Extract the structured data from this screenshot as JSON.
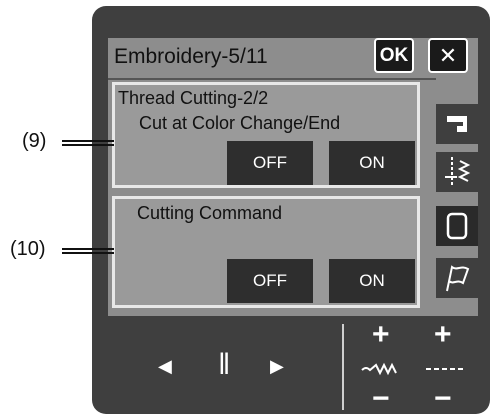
{
  "header": {
    "title": "Embroidery-5/11",
    "ok_label": "OK",
    "close_label": "✕"
  },
  "settings": {
    "thread_cutting": {
      "title": "Thread Cutting-2/2",
      "subtitle": "Cut at Color Change/End",
      "off_label": "OFF",
      "on_label": "ON"
    },
    "cutting_command": {
      "title": "Cutting Command",
      "off_label": "OFF",
      "on_label": "ON"
    }
  },
  "callouts": {
    "c9": "(9)",
    "c10": "(10)"
  },
  "controls": {
    "prev": "◀",
    "pause": "‖",
    "next": "▶",
    "plus": "+",
    "minus": "−"
  },
  "sidebar": {
    "tabs": [
      "sewing-machine-icon",
      "stitch-needle-icon",
      "embroidery-frame-icon",
      "flag-icon"
    ],
    "active_tab": "embroidery-frame-icon"
  }
}
